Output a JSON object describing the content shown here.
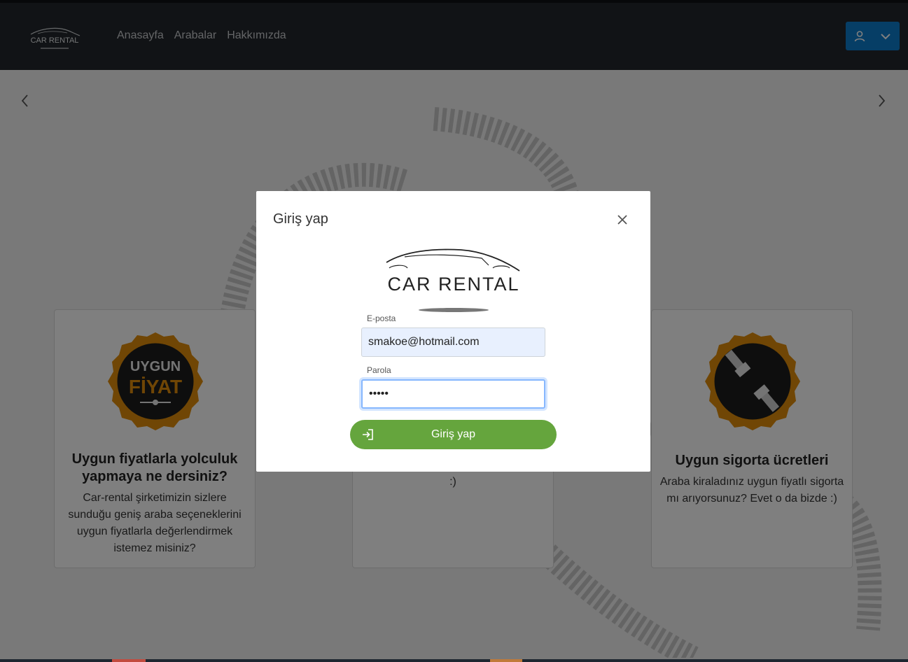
{
  "navbar": {
    "logo_text": "CAR RENTAL",
    "links": [
      {
        "label": "Anasayfa"
      },
      {
        "label": "Arabalar"
      },
      {
        "label": "Hakkımızda"
      }
    ],
    "user_icon": "user-icon",
    "dropdown_icon": "chevron-down-icon",
    "accent": "#0d7ccc"
  },
  "carousel": {
    "prev_icon": "chevron-left-icon",
    "next_icon": "chevron-right-icon"
  },
  "cards": [
    {
      "badge_text_1": "UYGUN",
      "badge_text_2": "FİYAT",
      "title": "Uygun fiyatlarla yolculuk yapmaya ne dersiniz?",
      "text": "Car-rental şirketimizin sizlere sunduğu geniş araba seçeneklerini uygun fiyatlarla değerlendirmek istemez misiniz?"
    },
    {
      "text": ":)"
    },
    {
      "badge_icon": "seatbelt-icon",
      "title": "Uygun sigorta ücretleri",
      "text": "Araba kiraladınız uygun fiyatlı sigorta mı arıyorsunuz? Evet o da bizde :)"
    }
  ],
  "login_modal": {
    "title": "Giriş yap",
    "logo_text": "CAR RENTAL",
    "email_label": "E-posta",
    "email_value": "smakoe@hotmail.com",
    "password_label": "Parola",
    "password_value": "•••••",
    "submit_label": "Giriş yap",
    "submit_icon": "login-icon",
    "close_icon": "close-icon",
    "submit_color": "#65a53d"
  }
}
